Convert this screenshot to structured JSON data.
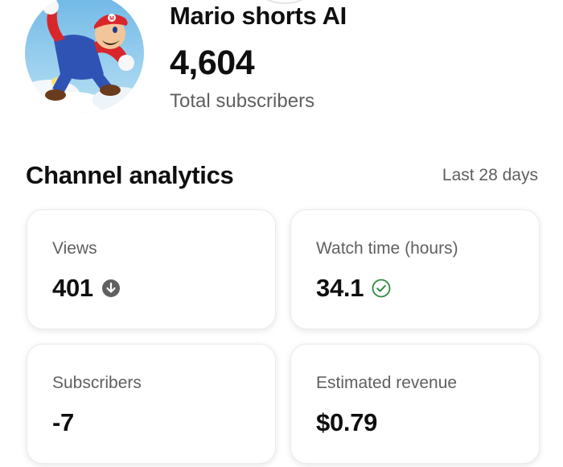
{
  "channel": {
    "name": "Mario shorts AI",
    "subscriber_count": "4,604",
    "subscriber_label": "Total subscribers"
  },
  "analytics": {
    "title": "Channel analytics",
    "period": "Last 28 days",
    "cards": [
      {
        "label": "Views",
        "value": "401",
        "icon": "down-arrow-icon",
        "icon_color": "#606060"
      },
      {
        "label": "Watch time (hours)",
        "value": "34.1",
        "icon": "check-circle-icon",
        "icon_color": "#2e8b3e"
      },
      {
        "label": "Subscribers",
        "value": "-7"
      },
      {
        "label": "Estimated revenue",
        "value": "$0.79"
      }
    ]
  }
}
